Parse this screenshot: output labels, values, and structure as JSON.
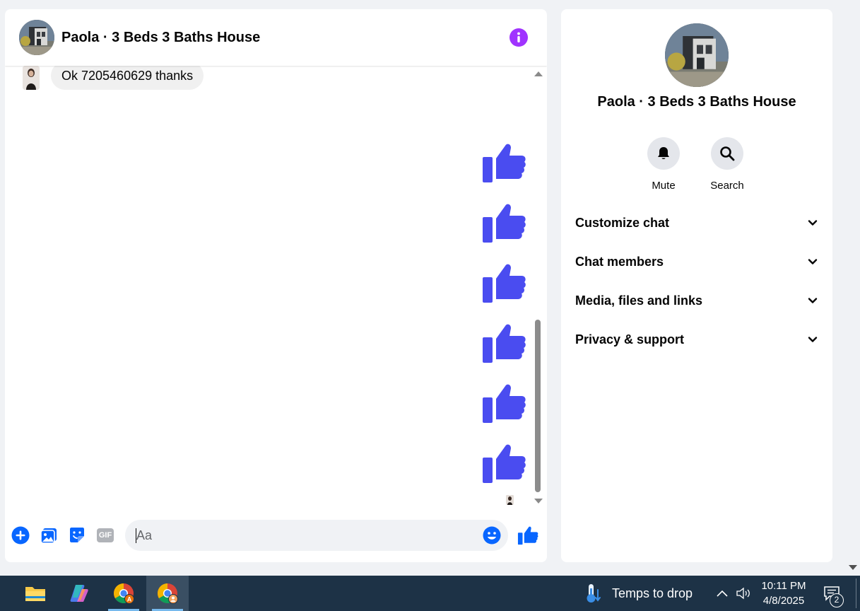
{
  "colors": {
    "accent": "#4a4cf0",
    "info": "#a033ff",
    "messenger_blue": "#0866ff",
    "taskbar": "#1d3246"
  },
  "chat": {
    "title": "Paola · 3 Beds 3 Baths House",
    "header_icons": [
      "info-icon"
    ],
    "messages": [
      {
        "from": "other",
        "text": "Ok 7205460629 thanks"
      }
    ],
    "sent_reactions": [
      "thumbs-up-icon",
      "thumbs-up-icon",
      "thumbs-up-icon",
      "thumbs-up-icon",
      "thumbs-up-icon",
      "thumbs-up-icon"
    ],
    "scroll_position": 0.9
  },
  "composer": {
    "placeholder": "Aa",
    "value": "",
    "icons": [
      "plus-circle-icon",
      "image-icon",
      "sticker-icon",
      "gif-icon",
      "emoji-icon",
      "thumbs-up-icon"
    ],
    "gif_label": "GIF"
  },
  "info_panel": {
    "title": "Paola · 3 Beds 3 Baths House",
    "actions": [
      {
        "label": "Mute",
        "icon": "bell-icon"
      },
      {
        "label": "Search",
        "icon": "search-icon"
      }
    ],
    "sections": [
      {
        "label": "Customize chat"
      },
      {
        "label": "Chat members"
      },
      {
        "label": "Media, files and links"
      },
      {
        "label": "Privacy & support"
      }
    ]
  },
  "taskbar": {
    "apps": [
      "file-explorer-icon",
      "copilot-icon",
      "chrome-icon",
      "chrome-profile-icon"
    ],
    "weather_text": "Temps to drop",
    "time": "10:11 PM",
    "date": "4/8/2025",
    "notifications_count": "2",
    "tray_icons": [
      "chevron-up-icon",
      "speaker-icon",
      "notification-icon"
    ]
  }
}
